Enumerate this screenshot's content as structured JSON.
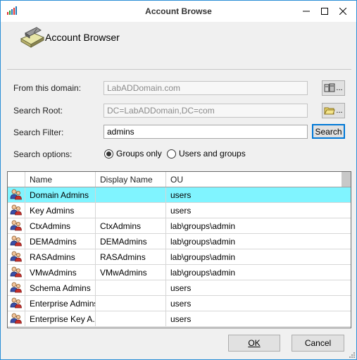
{
  "window": {
    "title": "Account Browse"
  },
  "banner": {
    "title": "Account Browser"
  },
  "form": {
    "domain_label": "From this domain:",
    "domain_value": "LabADDomain.com",
    "root_label": "Search Root:",
    "root_value": "DC=LabADDomain,DC=com",
    "filter_label": "Search Filter:",
    "filter_value": "admins",
    "search_button": "Search",
    "dots": "...",
    "options_label": "Search options:",
    "option_groups": "Groups only",
    "option_users": "Users and groups",
    "selected_option": "Groups only"
  },
  "grid": {
    "columns": [
      "Name",
      "Display Name",
      "OU"
    ],
    "rows": [
      {
        "name": "Domain Admins",
        "display": "",
        "ou": "users"
      },
      {
        "name": "Key Admins",
        "display": "",
        "ou": "users"
      },
      {
        "name": "CtxAdmins",
        "display": "CtxAdmins",
        "ou": "lab\\groups\\admin"
      },
      {
        "name": "DEMAdmins",
        "display": "DEMAdmins",
        "ou": "lab\\groups\\admin"
      },
      {
        "name": "RASAdmins",
        "display": "RASAdmins",
        "ou": "lab\\groups\\admin"
      },
      {
        "name": "VMwAdmins",
        "display": "VMwAdmins",
        "ou": "lab\\groups\\admin"
      },
      {
        "name": "Schema Admins",
        "display": "",
        "ou": "users"
      },
      {
        "name": "Enterprise Admins",
        "display": "",
        "ou": "users"
      },
      {
        "name": "Enterprise Key A...",
        "display": "",
        "ou": "users"
      }
    ],
    "selected_row": "Domain Admins"
  },
  "footer": {
    "ok": "OK",
    "cancel": "Cancel"
  },
  "icons": {
    "app": "app-bars-icon",
    "banner": "scanner-book-icon",
    "domain_button": "server-icon",
    "root_button": "folder-icon",
    "row": "group-users-icon"
  },
  "colors": {
    "accent_border": "#2b8fd6",
    "selected_row": "#80f4ff",
    "search_border": "#0078d7"
  }
}
